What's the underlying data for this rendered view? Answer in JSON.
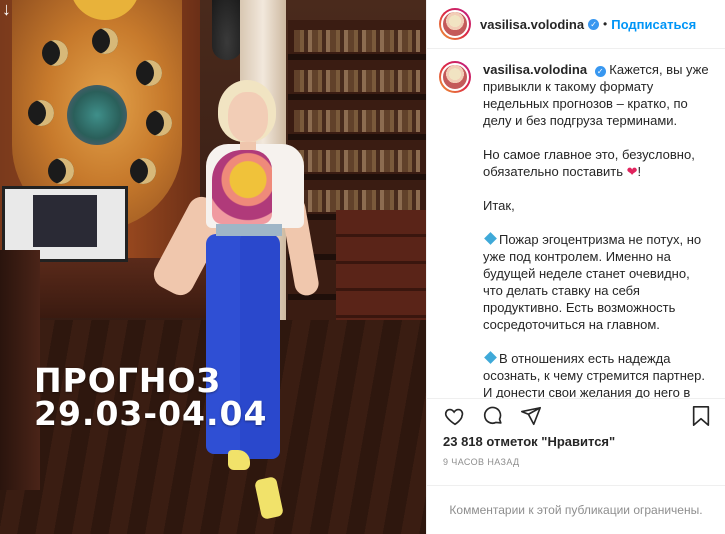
{
  "photo": {
    "caption_line1": "ПРОГНОЗ",
    "caption_line2": "29.03-04.04",
    "arrow_icon": "down-arrow-icon"
  },
  "header": {
    "username": "vasilisa.volodina",
    "separator": "•",
    "follow_label": "Подписаться"
  },
  "caption": {
    "username": "vasilisa.volodina",
    "p1": "Кажется, вы уже привыкли к такому формату недельных прогнозов – кратко, по делу и без подгруза терминами.",
    "p2_before": "Но самое главное это, безусловно, обязательно поставить ",
    "p2_heart": "❤",
    "p2_after": "!",
    "p3": "Итак,",
    "p4": "Пожар эгоцентризма не потух, но уже под контролем. Именно на будущей неделе станет очевидно, что делать ставку на себя продуктивно. Есть возможность сосредоточиться на главном.",
    "p5": "В отношениях есть надежда осознать, к чему стремится партнер. И донести свои желания до него в"
  },
  "likes": "23 818 отметок \"Нравится\"",
  "time": "9 часов назад",
  "comments_disabled": "Комментарии к этой публикации ограничены.",
  "colors": {
    "accent": "#0095f6",
    "verified": "#3897f0",
    "heart": "#e0245e",
    "diamond": "#3fa9d8"
  }
}
